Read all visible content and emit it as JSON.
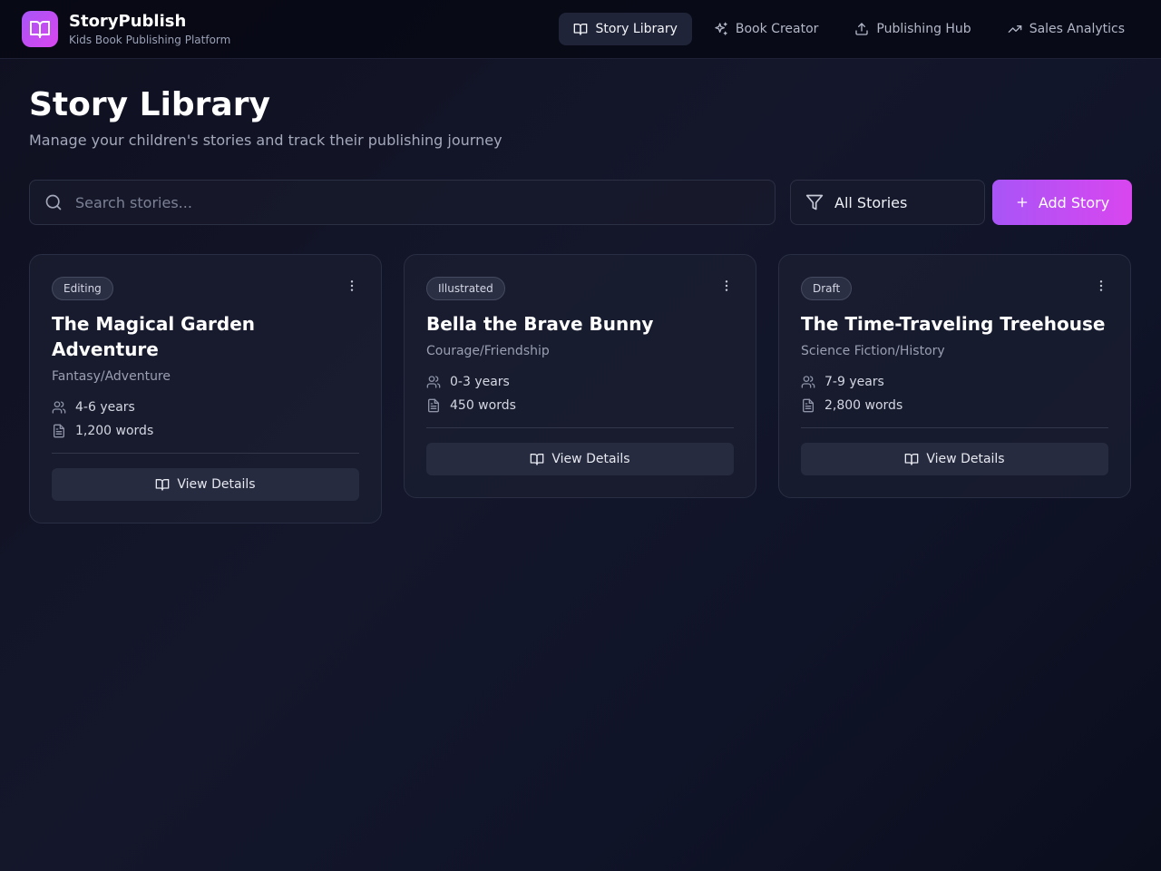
{
  "app": {
    "name": "StoryPublish",
    "subtitle": "Kids Book Publishing Platform"
  },
  "nav": [
    {
      "label": "Story Library",
      "icon": "book-open-icon",
      "active": true
    },
    {
      "label": "Book Creator",
      "icon": "sparkles-icon",
      "active": false
    },
    {
      "label": "Publishing Hub",
      "icon": "upload-icon",
      "active": false
    },
    {
      "label": "Sales Analytics",
      "icon": "trending-up-icon",
      "active": false
    }
  ],
  "page": {
    "title": "Story Library",
    "subtitle": "Manage your children's stories and track their publishing journey"
  },
  "search": {
    "placeholder": "Search stories...",
    "value": ""
  },
  "filter": {
    "selected": "All Stories"
  },
  "add_button": {
    "label": "Add Story"
  },
  "stories": [
    {
      "status": "Editing",
      "title": "The Magical Garden Adventure",
      "genre": "Fantasy/Adventure",
      "age": "4-6 years",
      "words": "1,200 words",
      "action": "View Details"
    },
    {
      "status": "Illustrated",
      "title": "Bella the Brave Bunny",
      "genre": "Courage/Friendship",
      "age": "0-3 years",
      "words": "450 words",
      "action": "View Details"
    },
    {
      "status": "Draft",
      "title": "The Time-Traveling Treehouse",
      "genre": "Science Fiction/History",
      "age": "7-9 years",
      "words": "2,800 words",
      "action": "View Details"
    }
  ],
  "colors": {
    "accent_start": "#a855f7",
    "accent_end": "#d946ef",
    "background": "#12142a",
    "card": "#1b1e30"
  }
}
